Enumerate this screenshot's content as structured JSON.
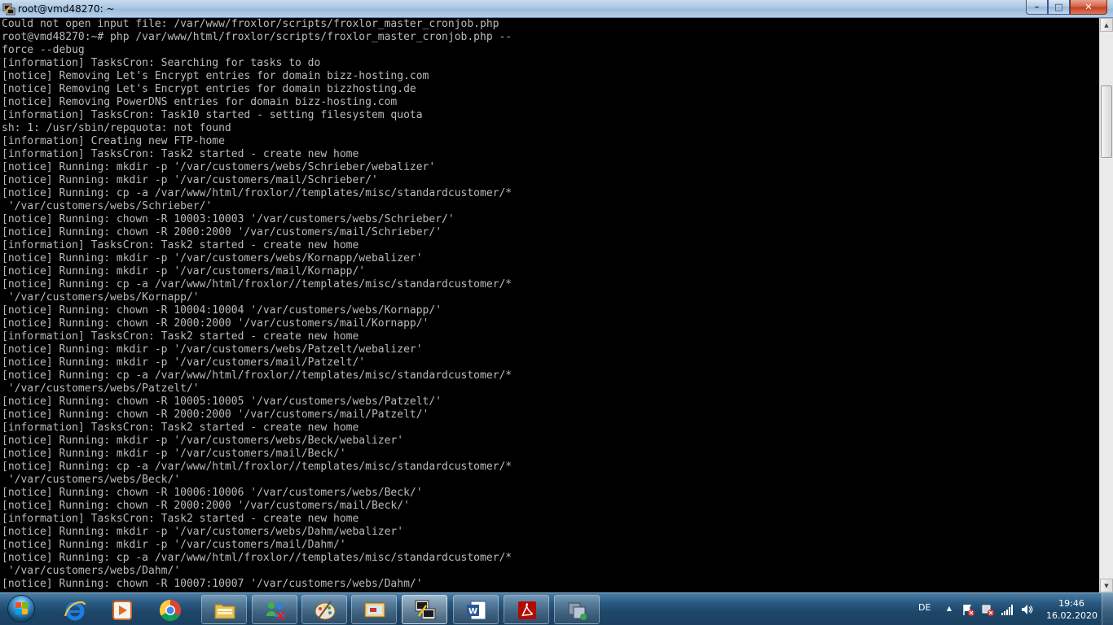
{
  "window": {
    "title": "root@vmd48270: ~",
    "controls": {
      "minimize": "–",
      "maximize": "□",
      "close": "✕"
    }
  },
  "terminal": {
    "lines": [
      "Could not open input file: /var/www/froxlor/scripts/froxlor_master_cronjob.php",
      "root@vmd48270:~# php /var/www/html/froxlor/scripts/froxlor_master_cronjob.php --",
      "force --debug",
      "[information] TasksCron: Searching for tasks to do",
      "[notice] Removing Let's Encrypt entries for domain bizz-hosting.com",
      "[notice] Removing Let's Encrypt entries for domain bizzhosting.de",
      "[notice] Removing PowerDNS entries for domain bizz-hosting.com",
      "[information] TasksCron: Task10 started - setting filesystem quota",
      "sh: 1: /usr/sbin/repquota: not found",
      "[information] Creating new FTP-home",
      "[information] TasksCron: Task2 started - create new home",
      "[notice] Running: mkdir -p '/var/customers/webs/Schrieber/webalizer'",
      "[notice] Running: mkdir -p '/var/customers/mail/Schrieber/'",
      "[notice] Running: cp -a /var/www/html/froxlor//templates/misc/standardcustomer/*",
      " '/var/customers/webs/Schrieber/'",
      "[notice] Running: chown -R 10003:10003 '/var/customers/webs/Schrieber/'",
      "[notice] Running: chown -R 2000:2000 '/var/customers/mail/Schrieber/'",
      "[information] TasksCron: Task2 started - create new home",
      "[notice] Running: mkdir -p '/var/customers/webs/Kornapp/webalizer'",
      "[notice] Running: mkdir -p '/var/customers/mail/Kornapp/'",
      "[notice] Running: cp -a /var/www/html/froxlor//templates/misc/standardcustomer/*",
      " '/var/customers/webs/Kornapp/'",
      "[notice] Running: chown -R 10004:10004 '/var/customers/webs/Kornapp/'",
      "[notice] Running: chown -R 2000:2000 '/var/customers/mail/Kornapp/'",
      "[information] TasksCron: Task2 started - create new home",
      "[notice] Running: mkdir -p '/var/customers/webs/Patzelt/webalizer'",
      "[notice] Running: mkdir -p '/var/customers/mail/Patzelt/'",
      "[notice] Running: cp -a /var/www/html/froxlor//templates/misc/standardcustomer/*",
      " '/var/customers/webs/Patzelt/'",
      "[notice] Running: chown -R 10005:10005 '/var/customers/webs/Patzelt/'",
      "[notice] Running: chown -R 2000:2000 '/var/customers/mail/Patzelt/'",
      "[information] TasksCron: Task2 started - create new home",
      "[notice] Running: mkdir -p '/var/customers/webs/Beck/webalizer'",
      "[notice] Running: mkdir -p '/var/customers/mail/Beck/'",
      "[notice] Running: cp -a /var/www/html/froxlor//templates/misc/standardcustomer/*",
      " '/var/customers/webs/Beck/'",
      "[notice] Running: chown -R 10006:10006 '/var/customers/webs/Beck/'",
      "[notice] Running: chown -R 2000:2000 '/var/customers/mail/Beck/'",
      "[information] TasksCron: Task2 started - create new home",
      "[notice] Running: mkdir -p '/var/customers/webs/Dahm/webalizer'",
      "[notice] Running: mkdir -p '/var/customers/mail/Dahm/'",
      "[notice] Running: cp -a /var/www/html/froxlor//templates/misc/standardcustomer/*",
      " '/var/customers/webs/Dahm/'",
      "[notice] Running: chown -R 10007:10007 '/var/customers/webs/Dahm/'"
    ]
  },
  "scrollbar": {
    "up_arrow": "▲",
    "down_arrow": "▼"
  },
  "taskbar": {
    "buttons": [
      {
        "name": "internet-explorer",
        "icon": "ie-icon"
      },
      {
        "name": "media-player",
        "icon": "media-player-icon"
      },
      {
        "name": "chrome",
        "icon": "chrome-icon"
      },
      {
        "name": "file-explorer",
        "icon": "folder-icon"
      },
      {
        "name": "network-app",
        "icon": "network-people-icon"
      },
      {
        "name": "paint",
        "icon": "paint-palette-icon"
      },
      {
        "name": "presentation-app",
        "icon": "presentation-icon"
      },
      {
        "name": "putty",
        "icon": "putty-icon"
      },
      {
        "name": "word",
        "icon": "word-icon"
      },
      {
        "name": "acrobat",
        "icon": "acrobat-icon"
      },
      {
        "name": "remote-app",
        "icon": "remote-app-icon"
      }
    ],
    "tray": {
      "language": "DE",
      "show_hidden": "▲",
      "time": "19:46",
      "date": "16.02.2020"
    }
  },
  "colors": {
    "terminal_bg": "#000000",
    "terminal_fg": "#bbbbbb",
    "taskbar": "#1d4668",
    "titlebar": "#aac6e3",
    "close_button": "#c7401f"
  }
}
